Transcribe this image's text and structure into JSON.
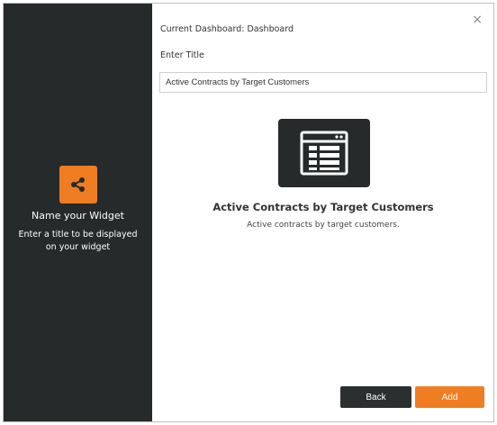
{
  "left_panel": {
    "icon": "share-icon",
    "title": "Name your Widget",
    "description": "Enter a title to be displayed on your widget",
    "accent_color": "#ef7d22",
    "background": "#262a2b"
  },
  "header": {
    "close_label": "×",
    "current_dashboard": "Current Dashboard: Dashboard"
  },
  "form": {
    "title_label": "Enter Title",
    "title_value": "Active Contracts by Target Customers"
  },
  "widget": {
    "icon": "table-widget-icon",
    "name": "Active Contracts by Target Customers",
    "description": "Active contracts by target customers."
  },
  "footer": {
    "back_label": "Back",
    "add_label": "Add"
  }
}
